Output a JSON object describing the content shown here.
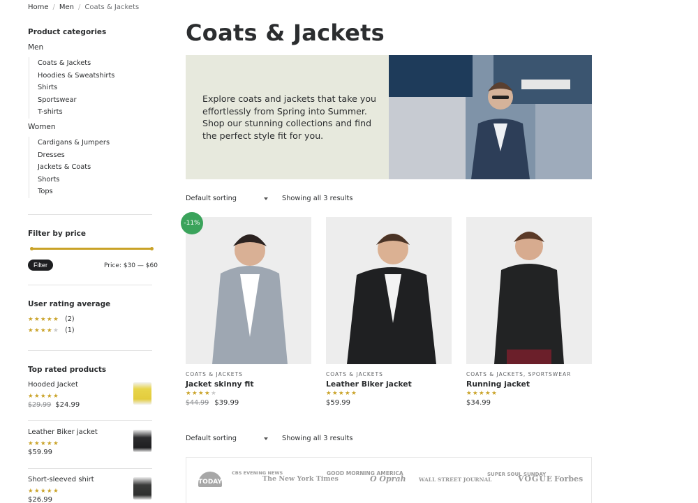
{
  "breadcrumb": {
    "home": "Home",
    "men": "Men",
    "current": "Coats & Jackets"
  },
  "sidebar": {
    "categories_title": "Product categories",
    "men": "Men",
    "men_items": [
      "Coats & Jackets",
      "Hoodies & Sweatshirts",
      "Shirts",
      "Sportswear",
      "T-shirts"
    ],
    "women": "Women",
    "women_items": [
      "Cardigans & Jumpers",
      "Dresses",
      "Jackets & Coats",
      "Shorts",
      "Tops"
    ],
    "filter_title": "Filter by price",
    "filter_button": "Filter",
    "price_range": "Price: $30 — $60",
    "price_min": 30,
    "price_max": 60,
    "rating_title": "User rating average",
    "ratings": [
      {
        "stars": 5,
        "count": "(2)"
      },
      {
        "stars": 4,
        "count": "(1)"
      }
    ],
    "top_rated_title": "Top rated products",
    "top_rated": [
      {
        "name": "Hooded Jacket",
        "stars": 5,
        "old_price": "$29.99",
        "price": "$24.99"
      },
      {
        "name": "Leather Biker jacket",
        "stars": 5,
        "old_price": "",
        "price": "$59.99"
      },
      {
        "name": "Short-sleeved shirt",
        "stars": 5,
        "old_price": "",
        "price": "$26.99"
      }
    ]
  },
  "main": {
    "title": "Coats & Jackets",
    "hero_text": "Explore coats and jackets that take you effortlessly from Spring into Summer. Shop our stunning collections and find the perfect style fit for you.",
    "sorting": "Default sorting",
    "results": "Showing all 3 results",
    "sale_badge": "-11%",
    "products": [
      {
        "categories": "Coats & Jackets",
        "title": "Jacket skinny fit",
        "stars": 4,
        "old_price": "$44.99",
        "price": "$39.99"
      },
      {
        "categories": "Coats & Jackets",
        "title": "Leather Biker jacket",
        "stars": 5,
        "old_price": "",
        "price": "$59.99"
      },
      {
        "categories": "Coats & Jackets, Sportswear",
        "title": "Running jacket",
        "stars": 5,
        "old_price": "",
        "price": "$34.99"
      }
    ],
    "press_logos": [
      "TODAY",
      "CBS EVENING NEWS",
      "The New York Times",
      "GOOD MORNING AMERICA",
      "O Oprah",
      "WALL STREET JOURNAL",
      "SUPER SOUL SUNDAY",
      "VOGUE",
      "Forbes"
    ]
  },
  "colors": {
    "accent": "#c9a227",
    "sale": "#3aa35b",
    "hero_bg": "#e7e9dd",
    "button": "#1d1e20"
  }
}
